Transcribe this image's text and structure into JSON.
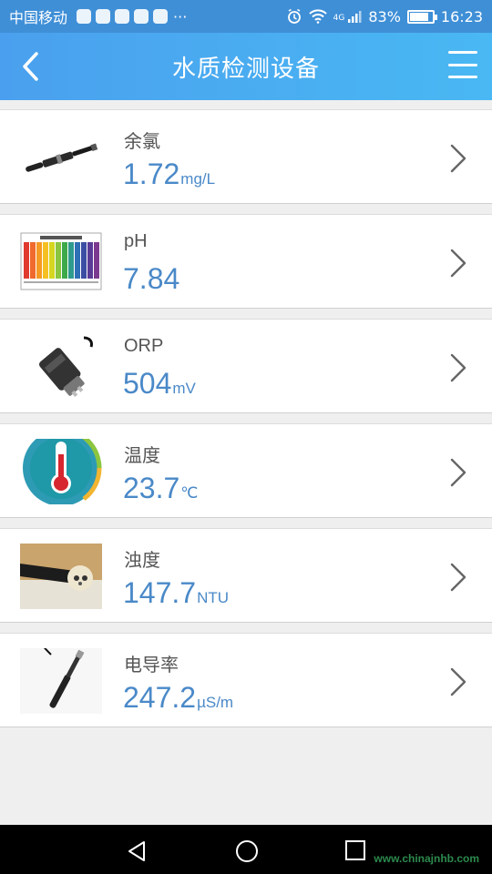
{
  "status_bar": {
    "carrier": "中国移动",
    "more": "···",
    "network": "4G",
    "battery_percent": "83%",
    "battery_level": 0.83,
    "time": "16:23"
  },
  "header": {
    "title": "水质检测设备",
    "back_icon": "back-chevron-icon",
    "menu_icon": "hamburger-menu-icon"
  },
  "devices": [
    {
      "name": "余氯",
      "value": "1.72",
      "unit": "mg/L",
      "image": "chlorine-sensor-probe"
    },
    {
      "name": "pH",
      "value": "7.84",
      "unit": "",
      "image": "ph-color-chart"
    },
    {
      "name": "ORP",
      "value": "504",
      "unit": "mV",
      "image": "orp-sensor-probe"
    },
    {
      "name": "温度",
      "value": "23.7",
      "unit": "℃",
      "image": "thermometer-icon"
    },
    {
      "name": "浊度",
      "value": "147.7",
      "unit": "NTU",
      "image": "turbidity-sensor-probe"
    },
    {
      "name": "电导率",
      "value": "247.2",
      "unit": "µS/m",
      "image": "conductivity-probe"
    }
  ],
  "nav_bar": {
    "watermark": "www.chinajnhb.com"
  },
  "colors": {
    "header_gradient_start": "#4aa0ee",
    "header_gradient_end": "#49b8f3",
    "reading_blue": "#4a89c8"
  }
}
